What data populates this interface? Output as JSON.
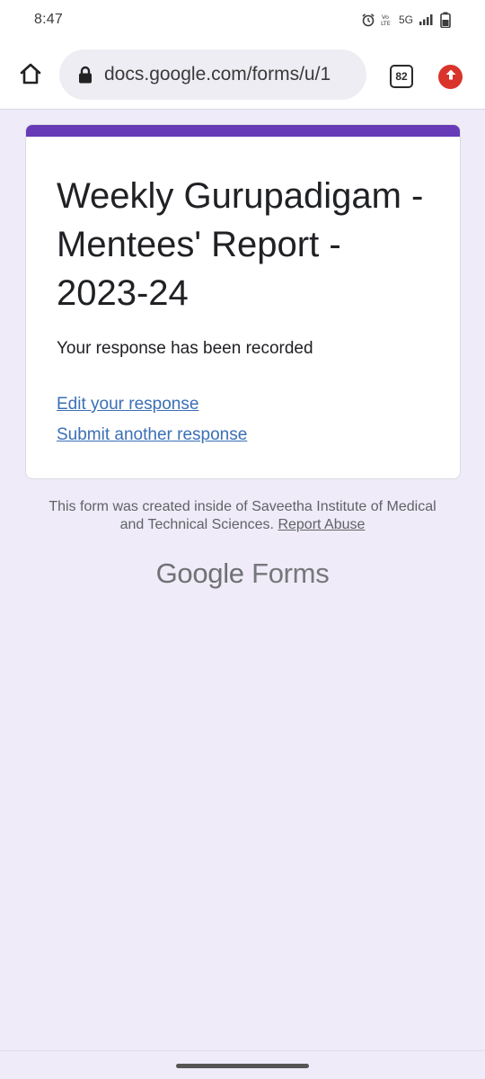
{
  "status_bar": {
    "time": "8:47",
    "network_label": "5G",
    "volte_label": "VoLTE"
  },
  "browser": {
    "url": "docs.google.com/forms/u/1",
    "tab_count": "82"
  },
  "form": {
    "title": "Weekly Gurupadigam - Mentees' Report - 2023-24",
    "confirmation": "Your response has been recorded",
    "edit_link": "Edit your response",
    "submit_another_link": "Submit another response",
    "accent_color": "#673ab7"
  },
  "footer": {
    "note_prefix": "This form was created inside of Saveetha Institute of Medical and Technical Sciences.",
    "report_abuse": "Report Abuse",
    "brand_google": "Google",
    "brand_forms": "Forms"
  },
  "icons": {
    "home": "home-icon",
    "lock": "lock-icon",
    "tabs": "tab-switcher-icon",
    "update": "update-arrow-icon",
    "alarm": "alarm-icon",
    "signal": "signal-icon",
    "battery": "battery-icon"
  }
}
